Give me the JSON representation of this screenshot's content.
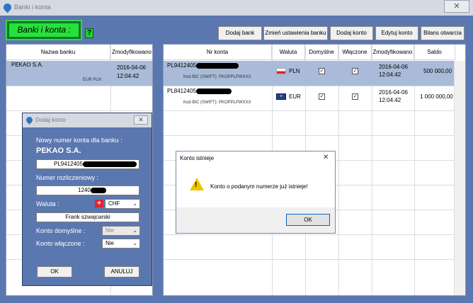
{
  "window": {
    "title": "Banki i konta",
    "close": "✕"
  },
  "banner": {
    "label": "Banki i konta :",
    "help": "?"
  },
  "toolbar": {
    "add_bank": "Dodaj bank",
    "change_bank_settings": "Zmień ustawienia banku",
    "add_account": "Dodaj konto",
    "edit_account": "Edytuj konto",
    "opening_balance": "Bilans otwarcia"
  },
  "banks": {
    "headers": {
      "name": "Nazwa banku",
      "modified": "Zmodyfikowano"
    },
    "rows": [
      {
        "name": "PEKAO S.A.",
        "currency": "EUR PLN",
        "date": "2016-04-06",
        "time": "12:04:42"
      }
    ]
  },
  "accounts": {
    "headers": {
      "number": "Nr konta",
      "currency": "Waluta",
      "default": "Domyślne",
      "enabled": "Włączone",
      "modified": "Zmodyfikowano",
      "balance": "Saldo"
    },
    "rows": [
      {
        "number": "PL9412405",
        "bic": "Kod BIC (SWIFT):   PKOPPLPWXXX",
        "currency": "PLN",
        "flag": "pl",
        "default": true,
        "enabled": true,
        "date": "2016-04-06",
        "time": "12:04:42",
        "balance": "500 000,00"
      },
      {
        "number": "PL8412405",
        "bic": "Kod BIC (SWIFT):   PKOPPLPWXXX",
        "currency": "EUR",
        "flag": "eu",
        "default": true,
        "enabled": true,
        "date": "2016-04-06",
        "time": "12:04:42",
        "balance": "1 000 000,00"
      }
    ]
  },
  "add_account_dialog": {
    "title": "Dodaj konto",
    "close": "✕",
    "new_number_label": "Nowy numer konta dla banku :",
    "bank_name": "PEKAO S.A.",
    "account_number": "PL9412405",
    "clearing_label": "Numer rozliczeniowy :",
    "clearing_number": "1240",
    "currency_label": "Waluta :",
    "currency_value": "CHF",
    "currency_name": "Frank szwajcarski",
    "default_label": "Konto domyślne :",
    "default_value": "Nie",
    "enabled_label": "Konto włączone :",
    "enabled_value": "Nie",
    "ok": "OK",
    "cancel": "ANULUJ"
  },
  "message_box": {
    "title": "Konto istnieje",
    "close": "✕",
    "text": "Konto o podanym numerze już istnieje!",
    "ok": "OK"
  },
  "colors": {
    "frame": "#5b77b0",
    "selection": "#a9bbd8",
    "banner_green": "#25e23b",
    "warning": "#f2c200"
  }
}
